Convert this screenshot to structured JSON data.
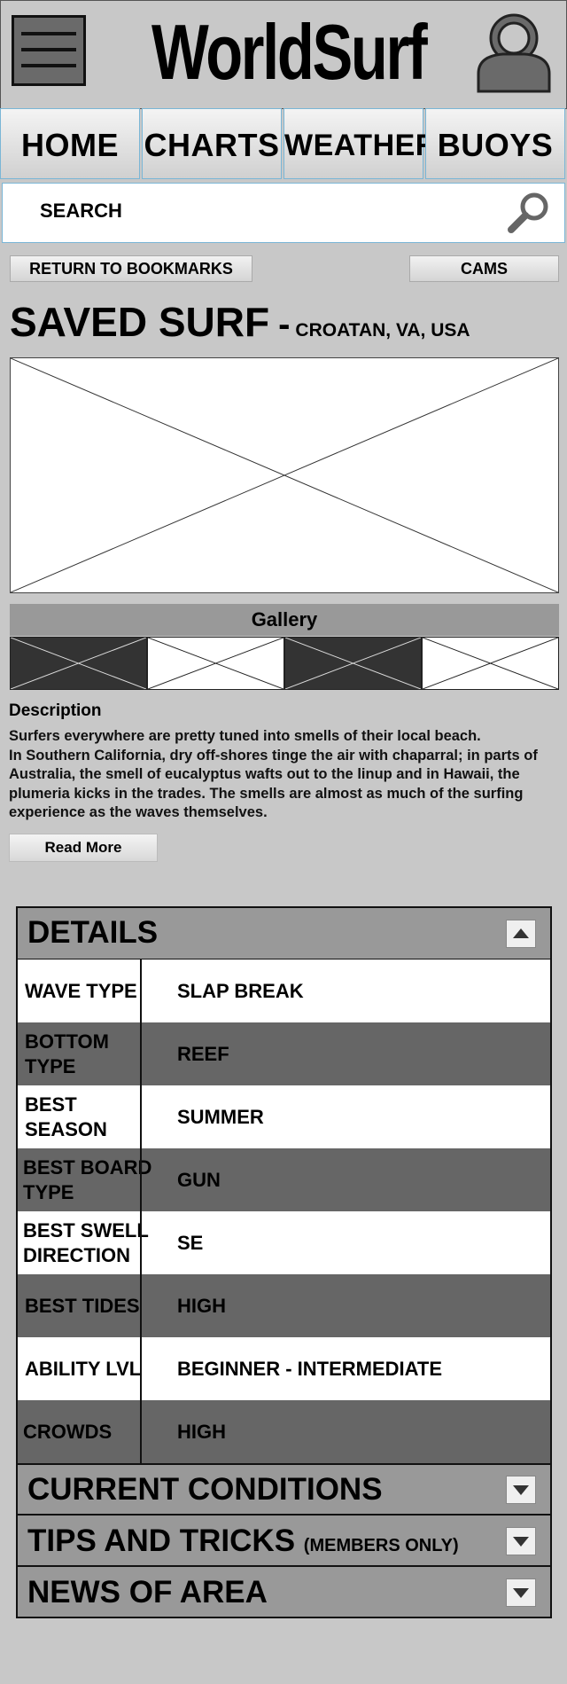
{
  "header": {
    "logo": "WorldSurf"
  },
  "nav": {
    "tabs": [
      "HOME",
      "CHARTS",
      "WEATHER",
      "BUOYS"
    ]
  },
  "search": {
    "label": "SEARCH"
  },
  "actions": {
    "return_label": "RETURN TO BOOKMARKS",
    "cams_label": "CAMS"
  },
  "page": {
    "title": "SAVED SURF",
    "dash": "-",
    "location": "CROATAN, VA, USA"
  },
  "gallery": {
    "label": "Gallery"
  },
  "description": {
    "title": "Description",
    "line1": "Surfers everywhere are pretty tuned into smells of their local beach.",
    "line2": "In Southern California, dry off-shores tinge the air with chaparral; in parts of Australia, the smell of eucalyptus wafts out to the linup and in Hawaii, the plumeria kicks in the trades. The smells are almost as much of the surfing experience as the waves themselves.",
    "read_more": "Read More"
  },
  "details": {
    "title": "DETAILS",
    "rows": [
      {
        "key": "WAVE TYPE",
        "value": "SLAP BREAK"
      },
      {
        "key": "BOTTOM TYPE",
        "value": "REEF"
      },
      {
        "key": "BEST SEASON",
        "value": "SUMMER"
      },
      {
        "key": "BEST BOARD TYPE",
        "value": "GUN"
      },
      {
        "key": "BEST SWELL DIRECTION",
        "value": "SE"
      },
      {
        "key": "BEST TIDES",
        "value": "HIGH"
      },
      {
        "key": "ABILITY LVL",
        "value": "BEGINNER - INTERMEDIATE"
      },
      {
        "key": "CROWDS",
        "value": "HIGH"
      }
    ]
  },
  "sections": {
    "current_conditions": "CURRENT CONDITIONS",
    "tips_title": "TIPS AND TRICKS",
    "tips_note": "(MEMBERS ONLY)",
    "news": "NEWS OF AREA"
  }
}
